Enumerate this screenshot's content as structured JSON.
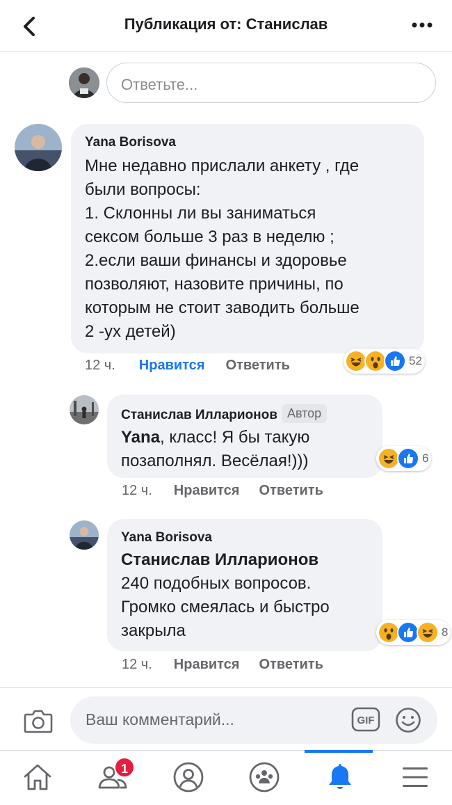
{
  "header": {
    "title": "Публикация от: Станислав"
  },
  "reply_box": {
    "placeholder": "Ответьте..."
  },
  "comments": [
    {
      "author": "Yana Borisova",
      "text": "Мне недавно прислали анкету , где\nбыли вопросы:\n1. Склонны ли вы заниматься\nсексом больше 3 раз в неделю ;\n2.если ваши финансы и здоровье\nпозволяют, назовите причины, по\nкоторым не стоит заводить больше\n2 -ух детей)",
      "time": "12 ч.",
      "like_label": "Нравится",
      "reply_label": "Ответить",
      "reaction_icons": [
        "haha",
        "wow",
        "like"
      ],
      "reaction_count": "52"
    },
    {
      "author": "Станислав Илларионов",
      "author_badge": "Автор",
      "mention": "Yana",
      "text": ", класс! Я бы такую\nпозаполнял. Весёлая!)))",
      "time": "12 ч.",
      "like_label": "Нравится",
      "reply_label": "Ответить",
      "reaction_icons": [
        "haha",
        "like"
      ],
      "reaction_count": "6"
    },
    {
      "author": "Yana Borisova",
      "mention": "Станислав Илларионов",
      "text": "240 подобных вопросов.\nГромко смеялась и быстро\nзакрыла",
      "time": "12 ч.",
      "like_label": "Нравится",
      "reply_label": "Ответить",
      "reaction_icons": [
        "wow",
        "like",
        "haha"
      ],
      "reaction_count": "8"
    }
  ],
  "composer": {
    "placeholder": "Ваш комментарий...",
    "gif_label": "GIF"
  },
  "tabbar": {
    "tabs": [
      "home-icon",
      "friends-icon",
      "profile-icon",
      "groups-icon",
      "notifications-icon",
      "menu-icon"
    ],
    "active_tab": "notifications-icon",
    "friends_badge": "1"
  },
  "colors": {
    "accent": "#1877f2",
    "bubble": "#f0f2f5",
    "meta": "#65676b",
    "badge_red": "#e41e3f"
  }
}
